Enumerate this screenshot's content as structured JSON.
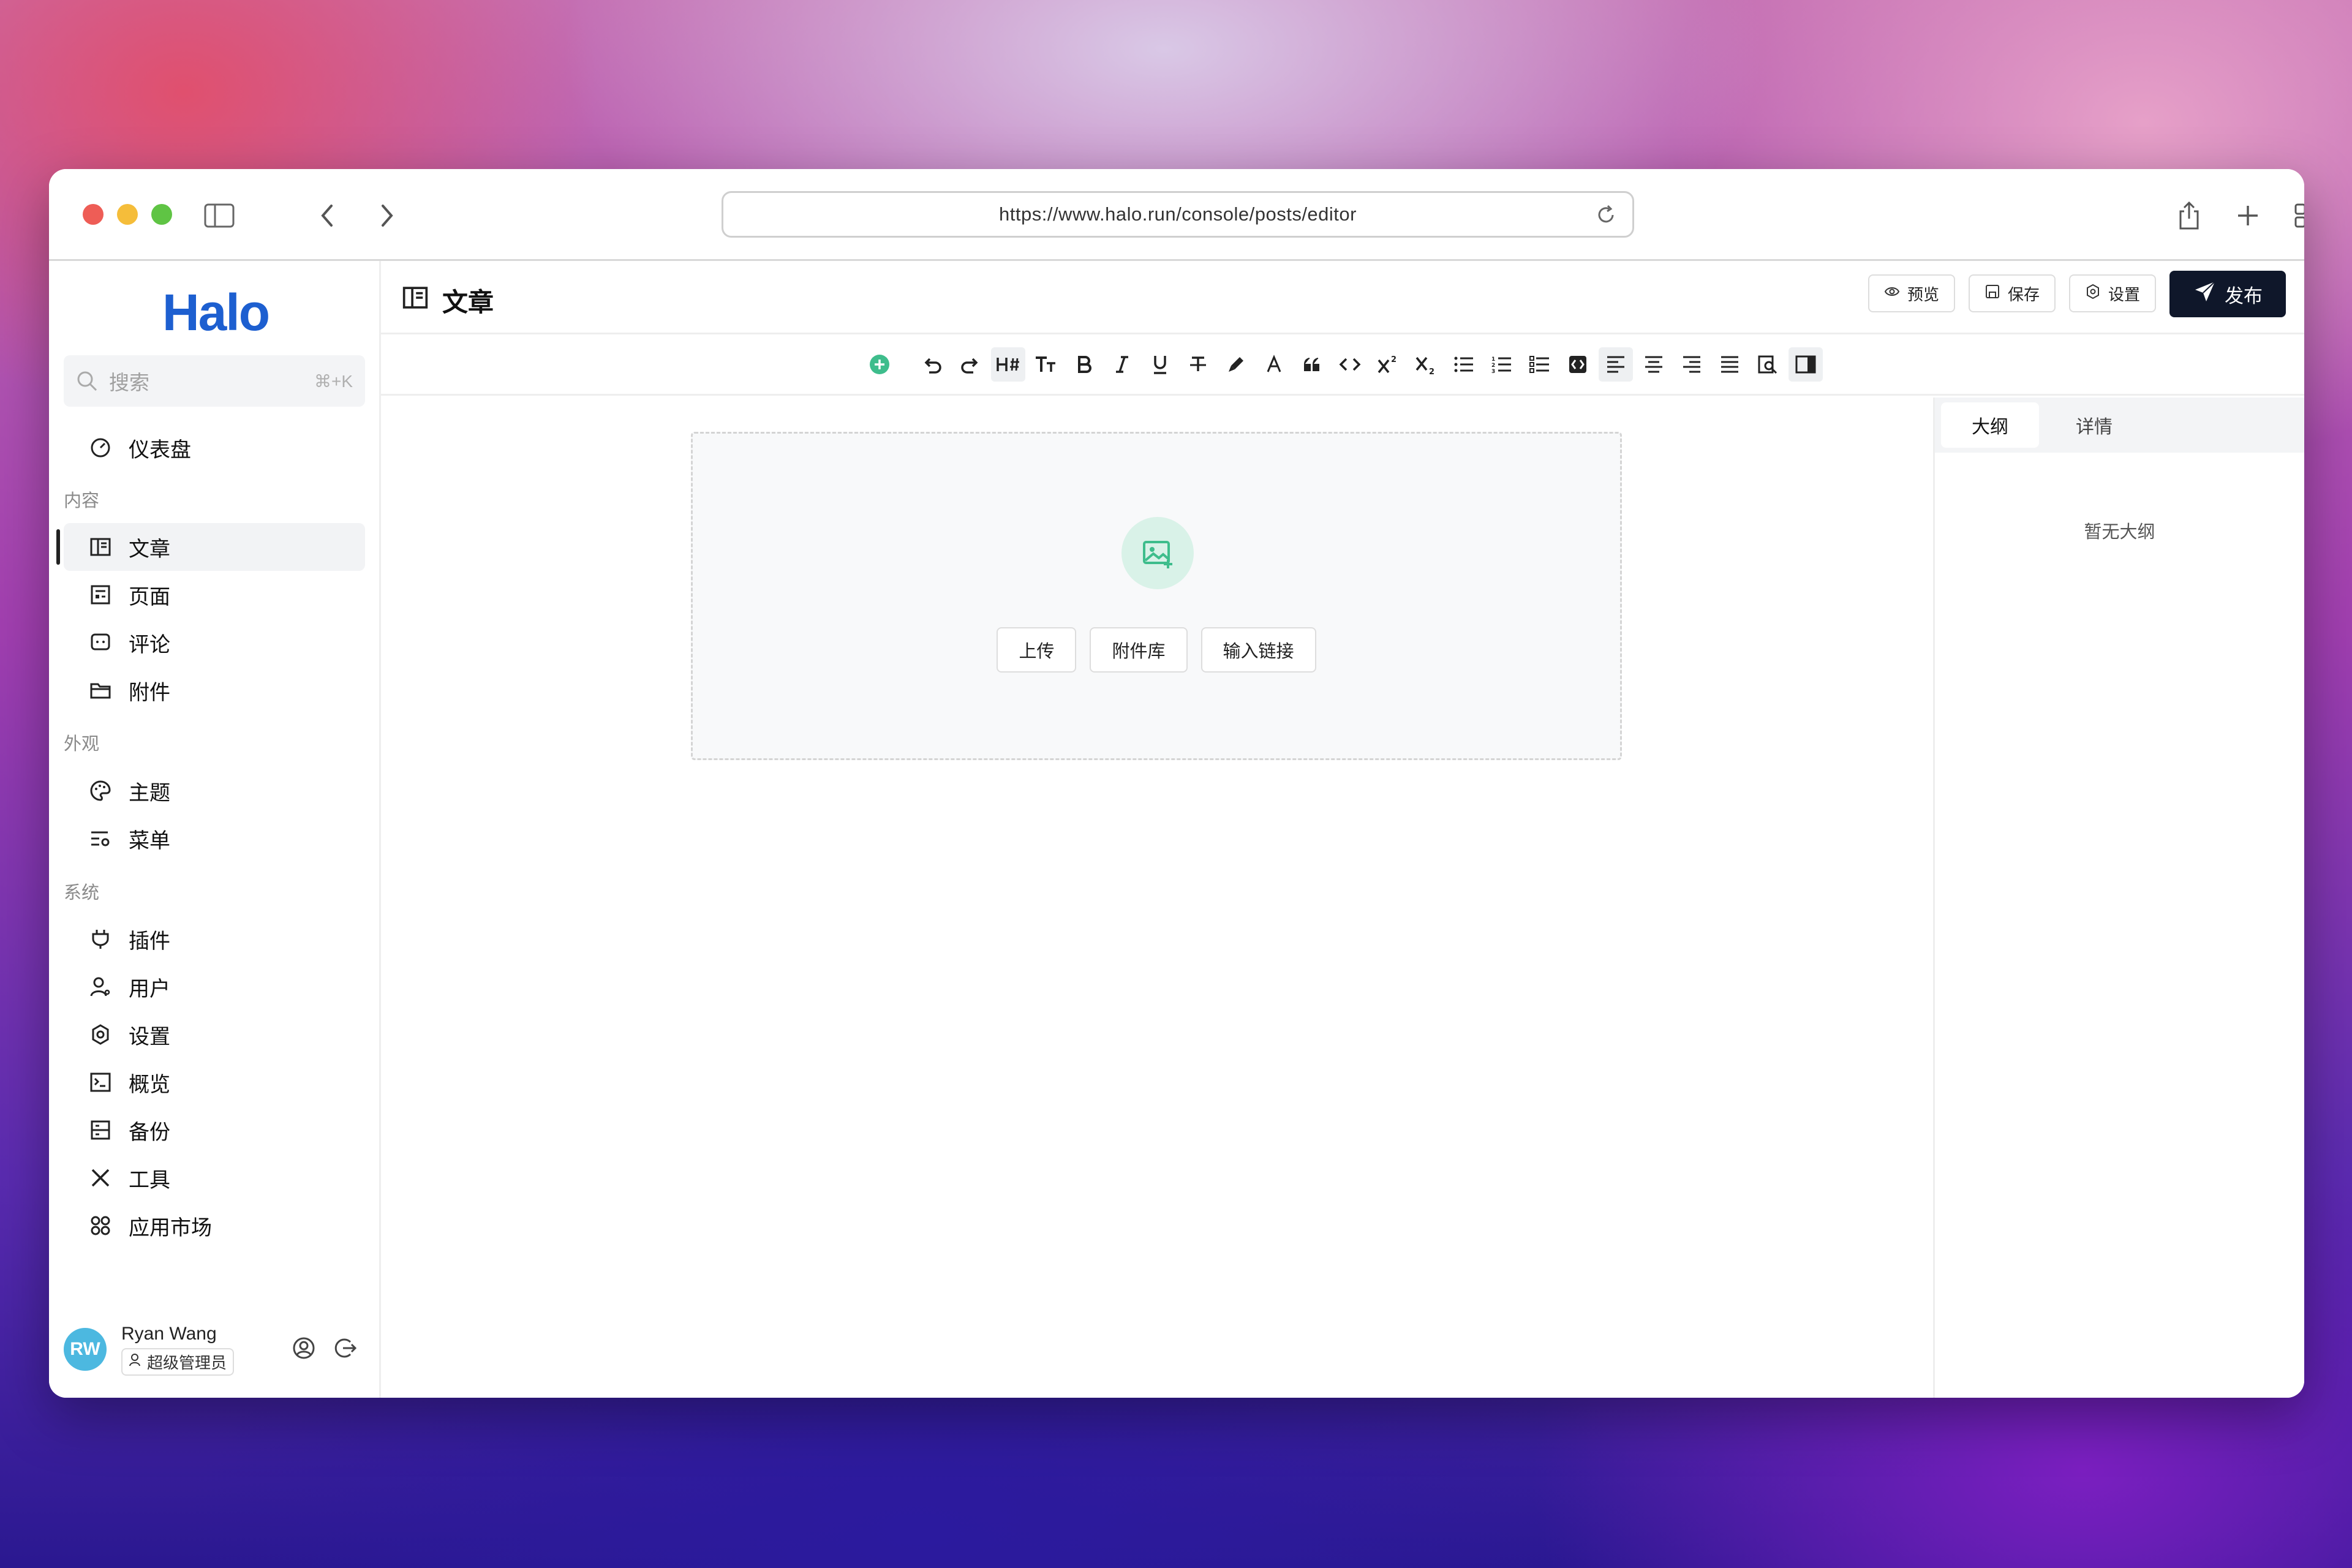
{
  "browser": {
    "url": "https://www.halo.run/console/posts/editor"
  },
  "sidebar": {
    "logo": "Halo",
    "search": {
      "placeholder": "搜索",
      "shortcut": "⌘+K"
    },
    "dashboard": "仪表盘",
    "sections": {
      "content": "内容",
      "appearance": "外观",
      "system": "系统"
    },
    "items": {
      "posts": "文章",
      "pages": "页面",
      "comments": "评论",
      "attachments": "附件",
      "themes": "主题",
      "menus": "菜单",
      "plugins": "插件",
      "users": "用户",
      "settings": "设置",
      "overview": "概览",
      "backup": "备份",
      "tools": "工具",
      "app_market": "应用市场"
    },
    "user": {
      "name": "Ryan Wang",
      "role": "超级管理员"
    }
  },
  "header": {
    "title": "文章",
    "preview": "预览",
    "save": "保存",
    "settings": "设置",
    "publish": "发布"
  },
  "editor": {
    "upload": "上传",
    "library": "附件库",
    "link": "输入链接"
  },
  "right_panel": {
    "tab_outline": "大纲",
    "tab_details": "详情",
    "empty": "暂无大纲"
  },
  "colors": {
    "accent": "#1d5fd0",
    "primary_button": "#0f172a",
    "green": "#3ebd8c"
  }
}
